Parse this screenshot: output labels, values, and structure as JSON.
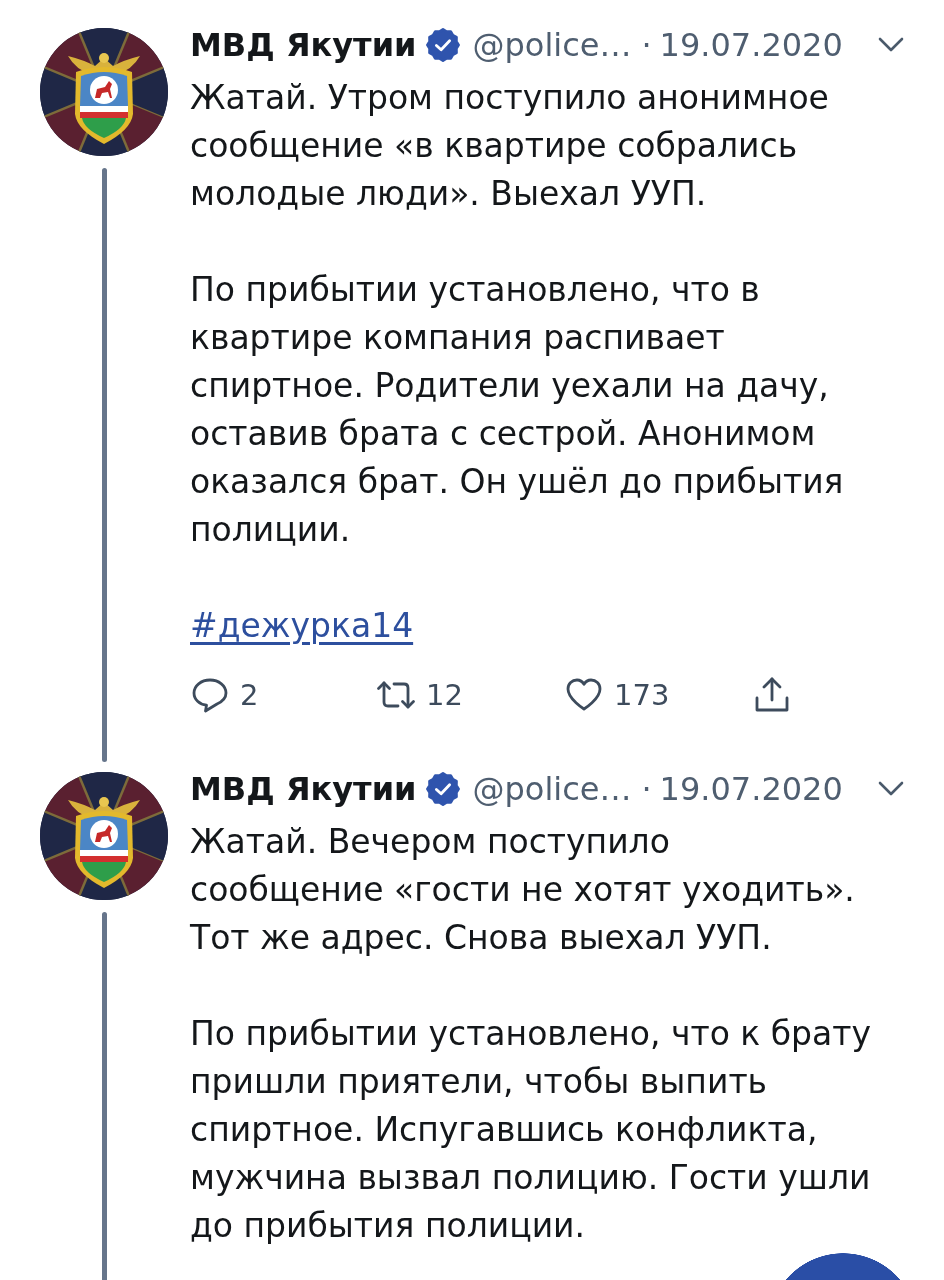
{
  "tweets": [
    {
      "author": {
        "name": "МВД Якутии",
        "verified": true,
        "handle": "@police…"
      },
      "separator": "·",
      "date": "19.07.2020",
      "connected_below": true,
      "paragraphs": [
        "Жатай. Утром поступило анонимное сообщение «в квартире собрались молодые люди». Выехал УУП.",
        "По прибытии установлено, что в квартире компания распивает спиртное. Родители уехали на дачу, оставив брата с сестрой. Анонимом оказался брат. Он ушёл до прибытия полиции."
      ],
      "hashtag": "#дежурка14",
      "actions": [
        {
          "kind": "reply",
          "count": "2"
        },
        {
          "kind": "retweet",
          "count": "12"
        },
        {
          "kind": "like",
          "count": "173"
        },
        {
          "kind": "share"
        }
      ]
    },
    {
      "author": {
        "name": "МВД Якутии",
        "verified": true,
        "handle": "@police…"
      },
      "separator": "·",
      "date": "19.07.2020",
      "connected_below": true,
      "paragraphs": [
        "Жатай. Вечером поступило\nсообщение «гости не хотят уходить». Тот же адрес. Снова выехал УУП.",
        "По прибытии установлено, что к брату пришли приятели, чтобы выпить спиртное. Испугавшись конфликта, мужчина вызвал полицию. Гости ушли до прибытия полиции."
      ]
    }
  ],
  "floating_button": {
    "visible": true
  }
}
